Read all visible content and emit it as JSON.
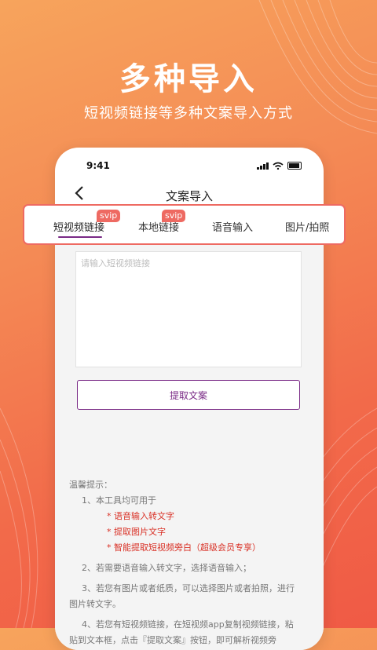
{
  "hero": {
    "title": "多种导入",
    "subtitle": "短视频链接等多种文案导入方式"
  },
  "status_bar": {
    "time": "9:41"
  },
  "nav": {
    "back_icon": "chevron-left-icon",
    "title": "文案导入"
  },
  "tabs": [
    {
      "label": "短视频链接",
      "badge": "svip",
      "active": true
    },
    {
      "label": "本地链接",
      "badge": "svip",
      "active": false
    },
    {
      "label": "语音输入",
      "badge": "",
      "active": false
    },
    {
      "label": "图片/拍照",
      "badge": "",
      "active": false
    }
  ],
  "input": {
    "placeholder": "请输入短视频链接"
  },
  "extract_button": "提取文案",
  "tips": {
    "heading": "温馨提示：",
    "line1": "1、本工具均可用于",
    "bullets": [
      "* 语音输入转文字",
      "* 提取图片文字",
      "* 智能提取短视频旁白（超级会员专享）"
    ],
    "line2": "2、若需要语音输入转文字，选择语音输入；",
    "line3a": "3、若您有图片或者纸质，可以选择图片或者拍照，进行",
    "line3b": "图片转文字。",
    "line4a": "4、若您有短视频链接，在短视频app复制视频链接，粘",
    "line4b": "贴到文本框，点击『提取文案』按钮，即可解析视频旁"
  },
  "colors": {
    "accent": "#7a2a86",
    "badge": "#ee6a62",
    "warning": "#d93025"
  }
}
